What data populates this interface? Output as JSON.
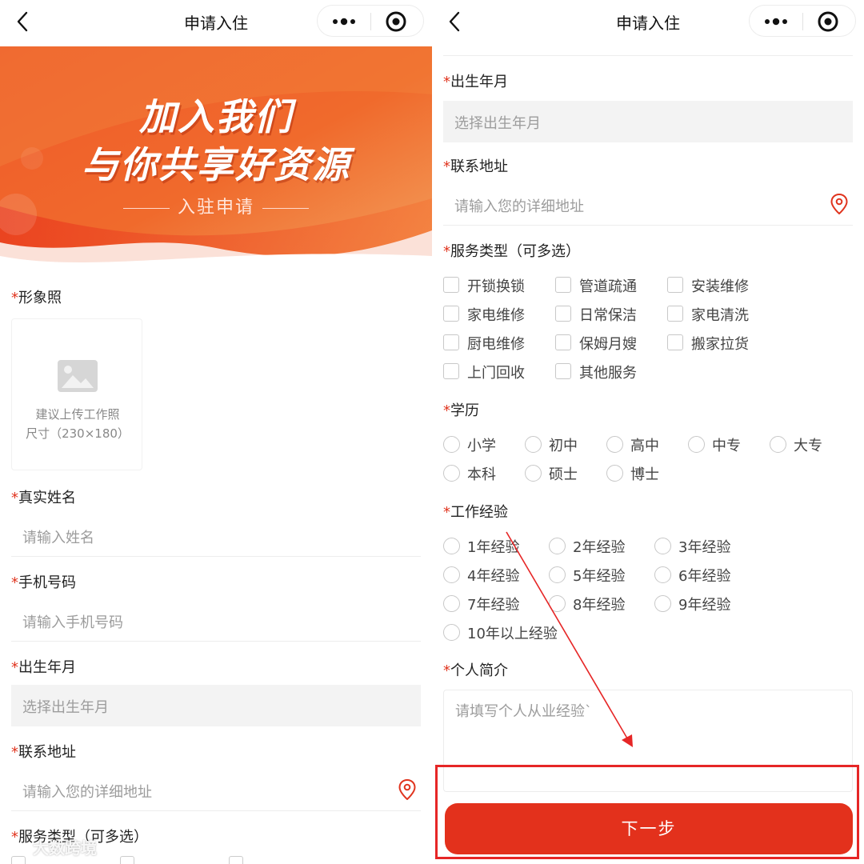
{
  "left": {
    "nav": {
      "title": "申请入住"
    },
    "banner": {
      "line1": "加入我们",
      "line2": "与你共享好资源",
      "subtitle": "入驻申请",
      "colors": {
        "primary": "#e8431f",
        "light": "#f79a57"
      }
    },
    "photo": {
      "label": "形象照",
      "hint_line1": "建议上传工作照",
      "hint_line2": "尺寸（230×180）"
    },
    "name": {
      "label": "真实姓名",
      "placeholder": "请输入姓名"
    },
    "phone": {
      "label": "手机号码",
      "placeholder": "请输入手机号码"
    },
    "birth": {
      "label": "出生年月",
      "placeholder": "选择出生年月"
    },
    "address": {
      "label": "联系地址",
      "placeholder": "请输入您的详细地址"
    },
    "service": {
      "label": "服务类型（可多选）"
    }
  },
  "right": {
    "nav": {
      "title": "申请入住"
    },
    "birth": {
      "label": "出生年月",
      "placeholder": "选择出生年月"
    },
    "address": {
      "label": "联系地址",
      "placeholder": "请输入您的详细地址"
    },
    "service": {
      "label": "服务类型（可多选）",
      "options": [
        "开锁换锁",
        "管道疏通",
        "安装维修",
        "家电维修",
        "日常保洁",
        "家电清洗",
        "厨电维修",
        "保姆月嫂",
        "搬家拉货",
        "上门回收",
        "其他服务"
      ]
    },
    "education": {
      "label": "学历",
      "options": [
        "小学",
        "初中",
        "高中",
        "中专",
        "大专",
        "本科",
        "硕士",
        "博士"
      ]
    },
    "experience": {
      "label": "工作经验",
      "options": [
        "1年经验",
        "2年经验",
        "3年经验",
        "4年经验",
        "5年经验",
        "6年经验",
        "7年经验",
        "8年经验",
        "9年经验",
        "10年以上经验"
      ]
    },
    "intro": {
      "label": "个人简介",
      "placeholder": "请填写个人从业经验`"
    },
    "next_button": "下一步"
  },
  "required_mark": "*",
  "watermark": "大数跨境",
  "accent_color": "#e3311c",
  "annotation_color": "#e62626"
}
